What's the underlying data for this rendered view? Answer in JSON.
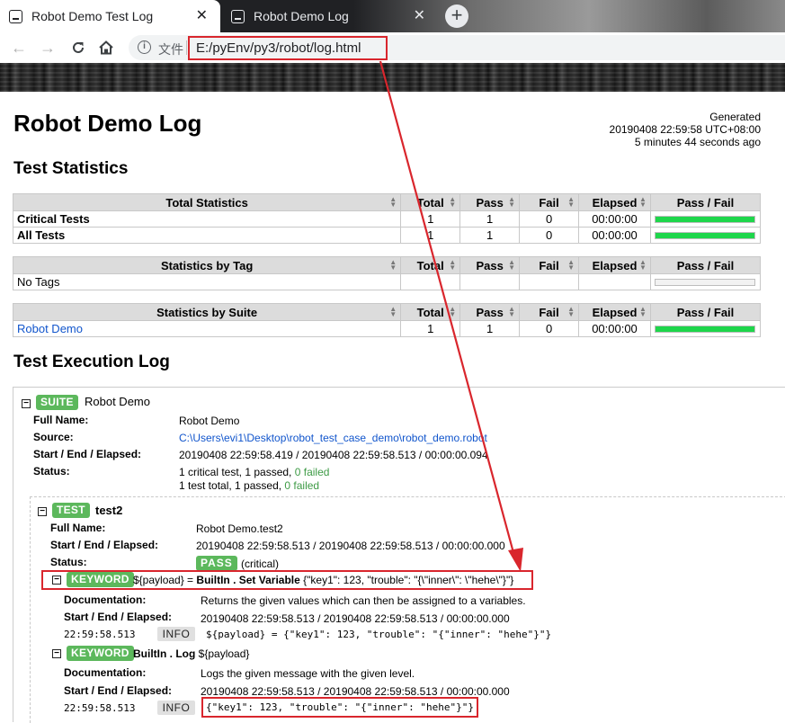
{
  "browser": {
    "tabs": [
      {
        "title": "Robot Demo Test Log",
        "active": true
      },
      {
        "title": "Robot Demo Log",
        "active": false
      }
    ],
    "new_tab_symbol": "+",
    "scheme_label": "文件",
    "url": "E:/pyEnv/py3/robot/log.html"
  },
  "header": {
    "title": "Robot Demo Log",
    "generated_label": "Generated",
    "generated_time": "20190408 22:59:58 UTC+08:00",
    "generated_ago": "5 minutes 44 seconds ago"
  },
  "statistics": {
    "heading": "Test Statistics",
    "columns": [
      "Total",
      "Pass",
      "Fail",
      "Elapsed",
      "Pass / Fail"
    ],
    "total": {
      "title": "Total Statistics",
      "rows": [
        {
          "name": "Critical Tests",
          "total": "1",
          "pass": "1",
          "fail": "0",
          "elapsed": "00:00:00",
          "pass_fraction": 1.0
        },
        {
          "name": "All Tests",
          "total": "1",
          "pass": "1",
          "fail": "0",
          "elapsed": "00:00:00",
          "pass_fraction": 1.0
        }
      ]
    },
    "tag": {
      "title": "Statistics by Tag",
      "empty": "No Tags"
    },
    "suite": {
      "title": "Statistics by Suite",
      "rows": [
        {
          "name": "Robot Demo",
          "total": "1",
          "pass": "1",
          "fail": "0",
          "elapsed": "00:00:00",
          "pass_fraction": 1.0
        }
      ]
    }
  },
  "execution": {
    "heading": "Test Execution Log",
    "suite": {
      "badge": "SUITE",
      "name": "Robot Demo",
      "labels": {
        "full_name": "Full Name:",
        "source": "Source:",
        "times": "Start / End / Elapsed:",
        "status": "Status:"
      },
      "full_name": "Robot Demo",
      "source": "C:\\Users\\evi1\\Desktop\\robot_test_case_demo\\robot_demo.robot",
      "times": "20190408 22:59:58.419 / 20190408 22:59:58.513 / 00:00:00.094",
      "status_critical_prefix": "1 critical test, 1 passed, ",
      "status_critical_failed": "0 failed",
      "status_total_prefix": "1 test total, 1 passed, ",
      "status_total_failed": "0 failed"
    },
    "test": {
      "badge": "TEST",
      "name": "test2",
      "full_name": "Robot Demo.test2",
      "times": "20190408 22:59:58.513 / 20190408 22:59:58.513 / 00:00:00.000",
      "status_badge": "PASS",
      "status_note": "(critical)"
    },
    "keywords": [
      {
        "badge": "KEYWORD",
        "assign": "${payload} = ",
        "library": "BuiltIn",
        "dot": " . ",
        "name": "Set Variable",
        "args": " {\"key1\": 123, \"trouble\": \"{\\\"inner\\\": \\\"hehe\\\"}\"}",
        "doc_label": "Documentation:",
        "doc": "Returns the given values which can then be assigned to a variables.",
        "times_label": "Start / End / Elapsed:",
        "times": "20190408 22:59:58.513 / 20190408 22:59:58.513 / 00:00:00.000",
        "msg_time": "22:59:58.513",
        "msg_level": "INFO",
        "msg": "${payload} = {\"key1\": 123, \"trouble\": \"{\"inner\": \"hehe\"}\"}"
      },
      {
        "badge": "KEYWORD",
        "assign": "",
        "library": "BuiltIn",
        "dot": " . ",
        "name": "Log",
        "args": " ${payload}",
        "doc_label": "Documentation:",
        "doc": "Logs the given message with the given level.",
        "times_label": "Start / End / Elapsed:",
        "times": "20190408 22:59:58.513 / 20190408 22:59:58.513 / 00:00:00.000",
        "msg_time": "22:59:58.513",
        "msg_level": "INFO",
        "msg": "{\"key1\": 123, \"trouble\": \"{\"inner\": \"hehe\"}\"}"
      }
    ]
  },
  "colors": {
    "pass_green": "#5cb85c",
    "bar_green": "#1ed64b",
    "link_blue": "#1155cc",
    "annotation_red": "#d9262d"
  }
}
